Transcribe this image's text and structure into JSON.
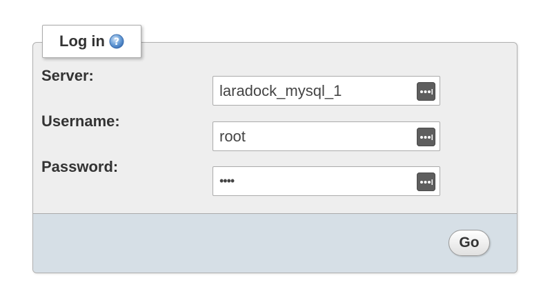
{
  "login": {
    "legend": "Log in",
    "help_icon": "help-icon"
  },
  "fields": {
    "server": {
      "label": "Server:",
      "value": "laradock_mysql_1",
      "icon": "more-dots-icon"
    },
    "username": {
      "label": "Username:",
      "value": "root",
      "icon": "more-dots-icon"
    },
    "password": {
      "label": "Password:",
      "value": "••••",
      "icon": "more-dots-icon"
    }
  },
  "footer": {
    "go_label": "Go"
  },
  "colors": {
    "panel": "#eeeeee",
    "footer": "#d6dfe6",
    "help_icon": "#6a9fd8"
  }
}
